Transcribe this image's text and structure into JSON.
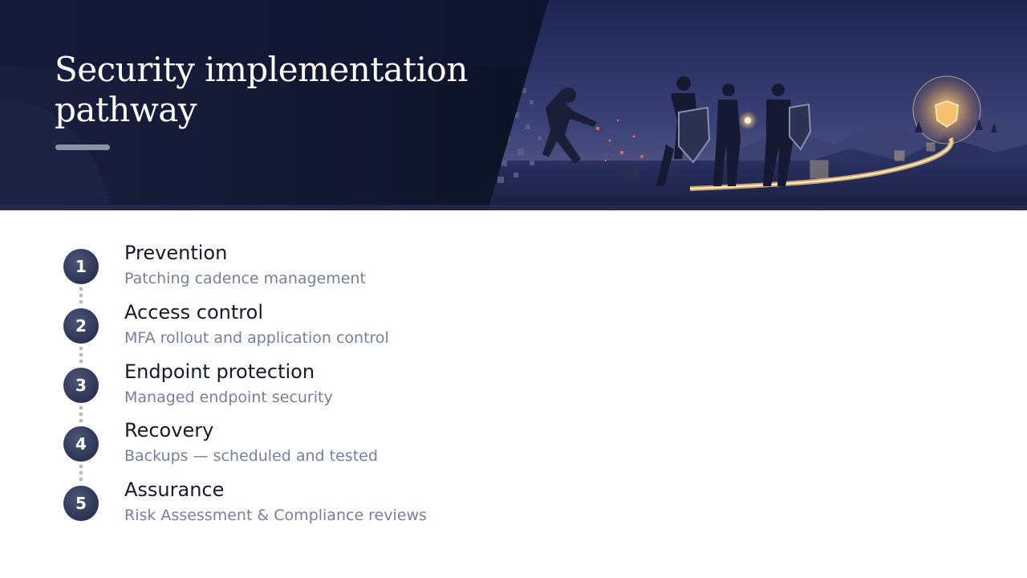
{
  "header": {
    "title_line1": "Security implementation",
    "title_line2": "pathway"
  },
  "steps": [
    {
      "number": "1",
      "title": "Prevention",
      "subtitle": "Patching cadence management"
    },
    {
      "number": "2",
      "title": "Access control",
      "subtitle": "MFA rollout and application control"
    },
    {
      "number": "3",
      "title": "Endpoint protection",
      "subtitle": "Managed endpoint security"
    },
    {
      "number": "4",
      "title": "Recovery",
      "subtitle": "Backups — scheduled and tested"
    },
    {
      "number": "5",
      "title": "Assurance",
      "subtitle": "Risk Assessment & Compliance reviews"
    }
  ],
  "colors": {
    "header_bg": "#141a33",
    "circle": "#2c3454",
    "title_text": "#161a2b",
    "subtitle_text": "#76809a",
    "accent_glow": "#f2b45a"
  }
}
